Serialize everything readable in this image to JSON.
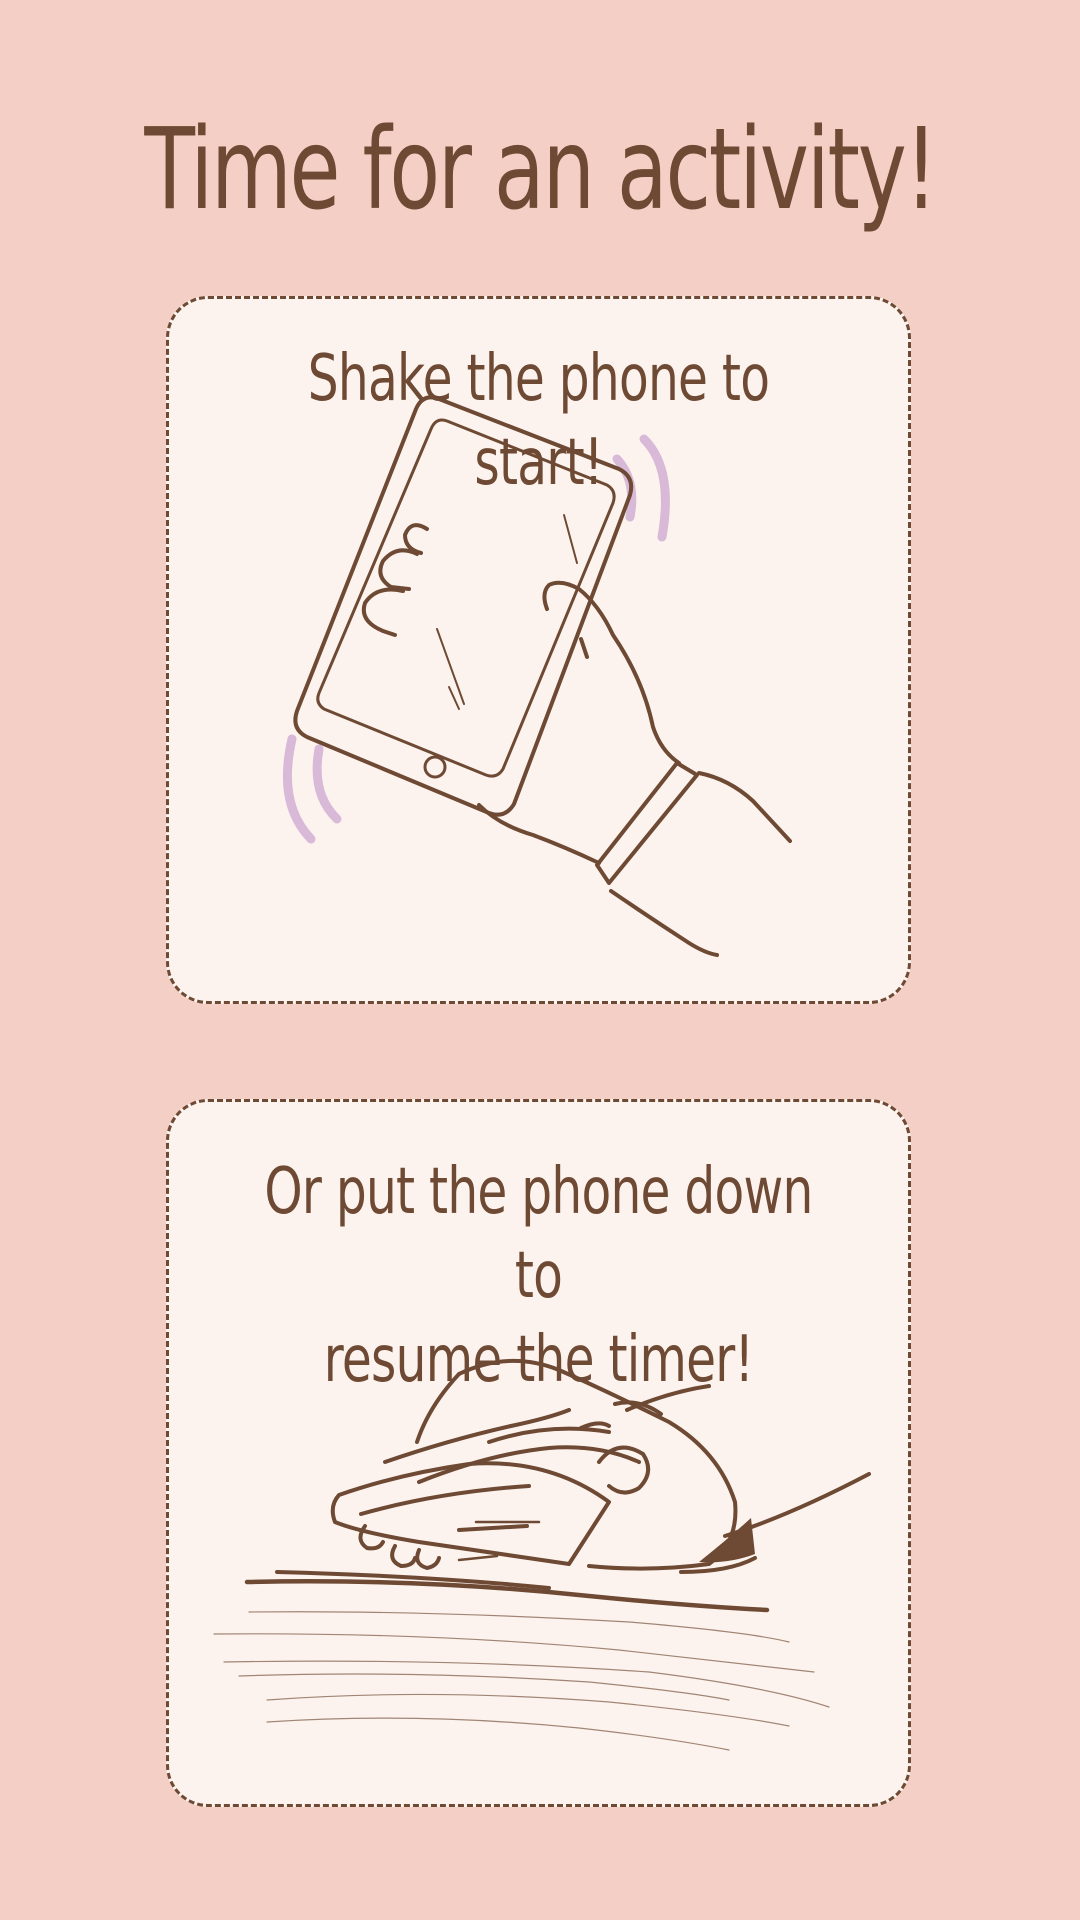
{
  "page": {
    "title": "Time for an activity!",
    "background_color": "#f3cfc6",
    "card_color": "#fdf3ee",
    "ink_color": "#6e4a34",
    "accent_color": "#d8b9d8"
  },
  "cards": [
    {
      "text": "Shake the phone to start!",
      "illustration": "hand-shaking-phone-icon"
    },
    {
      "text_lines": [
        "Or put the phone down to",
        "resume the timer!"
      ],
      "illustration": "hand-on-phone-on-table-icon"
    }
  ]
}
